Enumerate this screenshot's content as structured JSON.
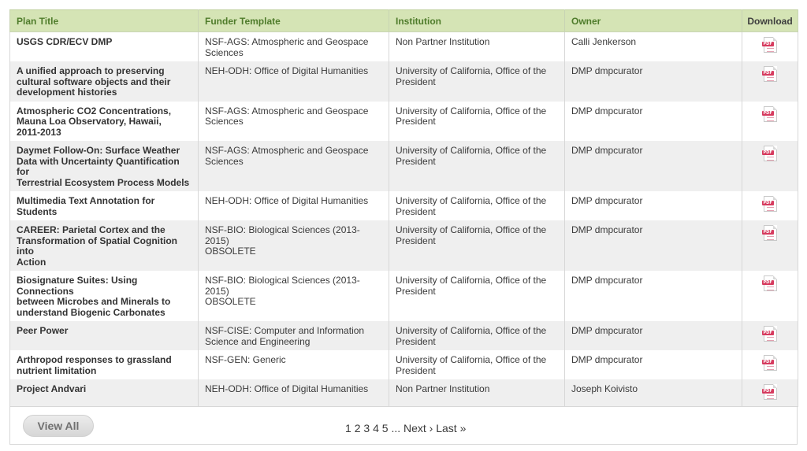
{
  "table": {
    "headers": {
      "plan_title": "Plan Title",
      "funder_template": "Funder Template",
      "institution": "Institution",
      "owner": "Owner",
      "download": "Download"
    },
    "rows": [
      {
        "title_lines": [
          "USGS CDR/ECV DMP"
        ],
        "funder_lines": [
          "NSF-AGS: Atmospheric and Geospace",
          "Sciences"
        ],
        "institution_lines": [
          "Non Partner Institution"
        ],
        "owner": "Calli Jenkerson"
      },
      {
        "title_lines": [
          "A unified approach to preserving",
          "cultural software objects and their",
          "development histories"
        ],
        "funder_lines": [
          "NEH-ODH: Office of Digital Humanities"
        ],
        "institution_lines": [
          "University of California, Office of the",
          "President"
        ],
        "owner": "DMP dmpcurator"
      },
      {
        "title_lines": [
          "Atmospheric CO2 Concentrations,",
          "Mauna Loa Observatory, Hawaii,",
          "2011-2013"
        ],
        "funder_lines": [
          "NSF-AGS: Atmospheric and Geospace",
          "Sciences"
        ],
        "institution_lines": [
          "University of California, Office of the",
          "President"
        ],
        "owner": "DMP dmpcurator"
      },
      {
        "title_lines": [
          "Daymet Follow-On: Surface Weather",
          "Data with Uncertainty Quantification for",
          "Terrestrial Ecosystem Process Models"
        ],
        "funder_lines": [
          "NSF-AGS: Atmospheric and Geospace",
          "Sciences"
        ],
        "institution_lines": [
          "University of California, Office of the",
          "President"
        ],
        "owner": "DMP dmpcurator"
      },
      {
        "title_lines": [
          "Multimedia Text Annotation for",
          "Students"
        ],
        "funder_lines": [
          "NEH-ODH: Office of Digital Humanities"
        ],
        "institution_lines": [
          "University of California, Office of the",
          "President"
        ],
        "owner": "DMP dmpcurator"
      },
      {
        "title_lines": [
          "CAREER: Parietal Cortex and the",
          "Transformation of Spatial Cognition into",
          "Action"
        ],
        "funder_lines": [
          "NSF-BIO: Biological Sciences (2013-2015)",
          "OBSOLETE"
        ],
        "institution_lines": [
          "University of California, Office of the",
          "President"
        ],
        "owner": "DMP dmpcurator"
      },
      {
        "title_lines": [
          "Biosignature Suites: Using Connections",
          "between Microbes and Minerals to",
          "understand Biogenic Carbonates"
        ],
        "funder_lines": [
          "NSF-BIO: Biological Sciences (2013-2015)",
          "OBSOLETE"
        ],
        "institution_lines": [
          "University of California, Office of the",
          "President"
        ],
        "owner": "DMP dmpcurator"
      },
      {
        "title_lines": [
          "Peer Power"
        ],
        "funder_lines": [
          "NSF-CISE: Computer and Information",
          "Science and Engineering"
        ],
        "institution_lines": [
          "University of California, Office of the",
          "President"
        ],
        "owner": "DMP dmpcurator"
      },
      {
        "title_lines": [
          "Arthropod responses to grassland",
          "nutrient limitation"
        ],
        "funder_lines": [
          "NSF-GEN: Generic"
        ],
        "institution_lines": [
          "University of California, Office of the",
          "President"
        ],
        "owner": "DMP dmpcurator"
      },
      {
        "title_lines": [
          "Project Andvari"
        ],
        "funder_lines": [
          "NEH-ODH: Office of Digital Humanities"
        ],
        "institution_lines": [
          "Non Partner Institution"
        ],
        "owner": "Joseph Koivisto"
      }
    ],
    "download_icon": "pdf-icon",
    "download_badge": "PDF"
  },
  "footer": {
    "view_all_label": "View All",
    "pages": [
      "1",
      "2",
      "3",
      "4",
      "5"
    ],
    "ellipsis": "...",
    "next_label": "Next ›",
    "last_label": "Last »"
  },
  "colors": {
    "header_bg": "#d5e4b5",
    "header_text": "#4f7c2b",
    "row_alt_bg": "#efefef",
    "pdf_badge": "#d63a5e"
  }
}
